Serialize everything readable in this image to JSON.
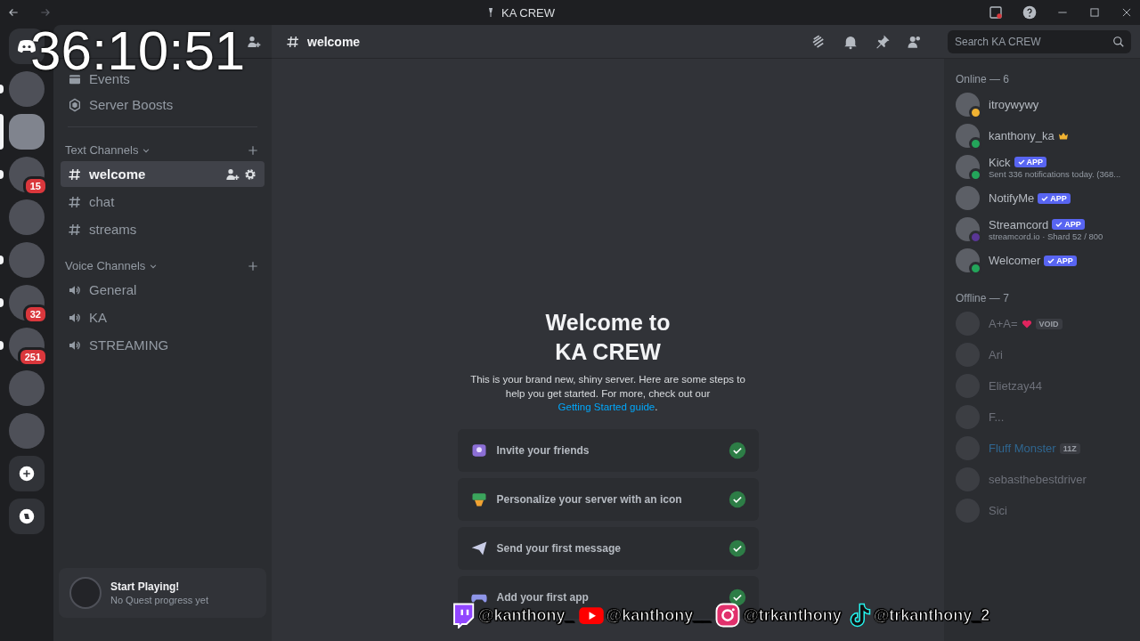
{
  "titlebar": {
    "title": "KA CREW"
  },
  "overlay": {
    "timer": "36:10:51",
    "socials": [
      {
        "kind": "twitch",
        "handle": "@kanthony_"
      },
      {
        "kind": "youtube",
        "handle": "@kanthony__"
      },
      {
        "kind": "instagram",
        "handle": "@trkanthony"
      },
      {
        "kind": "tiktok",
        "handle": "@trkanthony_2"
      }
    ]
  },
  "servers": [
    {
      "kind": "home",
      "selected": false,
      "unread": false
    },
    {
      "kind": "server",
      "selected": false,
      "unread": true
    },
    {
      "kind": "server",
      "selected": true,
      "unread": false
    },
    {
      "kind": "server",
      "selected": false,
      "unread": true,
      "badge": "15"
    },
    {
      "kind": "server",
      "selected": false,
      "unread": false
    },
    {
      "kind": "server",
      "selected": false,
      "unread": true
    },
    {
      "kind": "server",
      "selected": false,
      "unread": true,
      "badge": "32"
    },
    {
      "kind": "server",
      "selected": false,
      "unread": true,
      "badge": "251"
    },
    {
      "kind": "server",
      "selected": false,
      "unread": false
    },
    {
      "kind": "server",
      "selected": false,
      "unread": false
    },
    {
      "kind": "add",
      "selected": false,
      "unread": false
    },
    {
      "kind": "discover",
      "selected": false,
      "unread": false
    }
  ],
  "sidebar": {
    "items": [
      {
        "kind": "events",
        "label": "Events"
      },
      {
        "kind": "boosts",
        "label": "Server Boosts"
      }
    ],
    "categories": [
      {
        "name": "Text Channels",
        "kind": "text",
        "channels": [
          {
            "name": "welcome",
            "selected": true
          },
          {
            "name": "chat",
            "selected": false
          },
          {
            "name": "streams",
            "selected": false
          }
        ]
      },
      {
        "name": "Voice Channels",
        "kind": "voice",
        "channels": [
          {
            "name": "General",
            "selected": false
          },
          {
            "name": "KA",
            "selected": false
          },
          {
            "name": "STREAMING",
            "selected": false
          }
        ]
      }
    ],
    "quest": {
      "title": "Start Playing!",
      "subtitle": "No Quest progress yet"
    }
  },
  "header": {
    "channel": "welcome",
    "search": {
      "placeholder": "Search KA CREW"
    }
  },
  "welcome": {
    "title": "Welcome to KA CREW",
    "text": "This is your brand new, shiny server. Here are some steps to help you get started. For more, check out our",
    "link": "Getting Started guide",
    "after": ".",
    "steps": [
      {
        "kind": "invite",
        "label": "Invite your friends",
        "done": true
      },
      {
        "kind": "icon",
        "label": "Personalize your server with an icon",
        "done": true
      },
      {
        "kind": "message",
        "label": "Send your first message",
        "done": true
      },
      {
        "kind": "app",
        "label": "Add your first app",
        "done": true
      }
    ]
  },
  "members": [
    {
      "title": "Online — 6",
      "offline": false,
      "members": [
        {
          "name": "itroywywy",
          "kind": "idle",
          "owner": false
        },
        {
          "name": "kanthony_ka",
          "kind": "online",
          "owner": true
        },
        {
          "name": "Kick",
          "kind": "online",
          "owner": false,
          "badge": "APP",
          "subtitle": "Sent 336 notifications today. (368..."
        },
        {
          "name": "NotifyMe",
          "kind": "plain",
          "owner": false,
          "badge": "APP"
        },
        {
          "name": "Streamcord",
          "kind": "streaming",
          "owner": false,
          "badge": "APP",
          "subtitle": "streamcord.io · Shard 52 / 800"
        },
        {
          "name": "Welcomer",
          "kind": "online",
          "owner": false,
          "badge": "APP"
        }
      ]
    },
    {
      "title": "Offline — 7",
      "offline": true,
      "members": [
        {
          "name": "A+A=",
          "kind": "plain",
          "owner": false,
          "heart": true,
          "tag": "VOID"
        },
        {
          "name": "Ari",
          "kind": "plain",
          "owner": false
        },
        {
          "name": "Elietzay44",
          "kind": "plain",
          "owner": false
        },
        {
          "name": "F...",
          "kind": "plain",
          "owner": false
        },
        {
          "name": "Fluff Monster",
          "kind": "plain",
          "owner": false,
          "color": "#2f6690",
          "tag": "11Z"
        },
        {
          "name": "sebasthebestdriver",
          "kind": "plain",
          "owner": false
        },
        {
          "name": "Sici",
          "kind": "plain",
          "owner": false
        }
      ]
    }
  ]
}
